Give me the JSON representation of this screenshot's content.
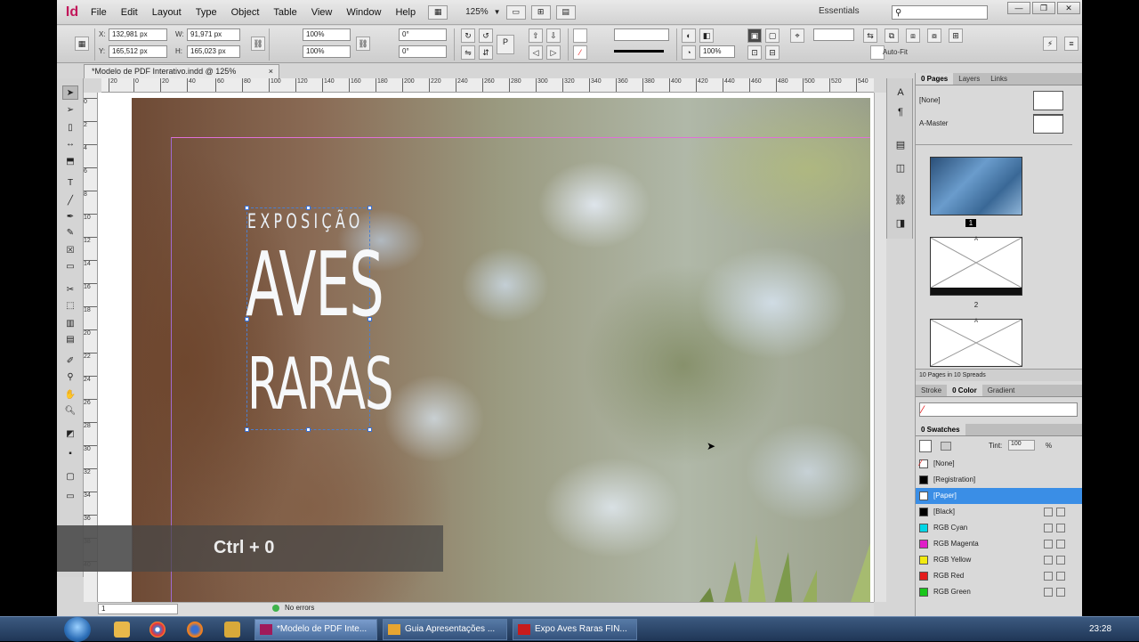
{
  "app": {
    "logo": "Id",
    "menus": [
      "File",
      "Edit",
      "Layout",
      "Type",
      "Object",
      "Table",
      "View",
      "Window",
      "Help"
    ],
    "zoom": "125%",
    "workspace": "Essentials",
    "search_placeholder": ""
  },
  "control": {
    "x": "132,981 px",
    "y": "165,512 px",
    "w": "91,971 px",
    "h": "165,023 px",
    "scale_x": "100%",
    "scale_y": "100%",
    "rotate": "0°",
    "shear": "0°",
    "stroke_pct": "100%",
    "autofit": "Auto-Fit"
  },
  "document": {
    "tab_title": "*Modelo de PDF Interativo.indd @ 125%",
    "close": "×"
  },
  "ruler": {
    "h_labels": [
      "20",
      "0",
      "20",
      "40",
      "60",
      "80",
      "100",
      "120",
      "140",
      "160",
      "180",
      "200",
      "220",
      "240",
      "260",
      "280",
      "300",
      "320",
      "340",
      "360",
      "380",
      "400",
      "420",
      "440",
      "460",
      "480",
      "500",
      "520",
      "540"
    ],
    "v_labels": [
      "0",
      "2",
      "4",
      "6",
      "8",
      "10",
      "12",
      "14",
      "16",
      "18",
      "20",
      "22",
      "24",
      "26",
      "28",
      "30",
      "32",
      "34",
      "36",
      "38",
      "40"
    ]
  },
  "canvas": {
    "line1": "EXPOSIÇÃO",
    "line2": "AVES",
    "line3": "RARAS"
  },
  "overlay": {
    "keystroke": "Ctrl + 0"
  },
  "status": {
    "page": "1",
    "errors": "No errors"
  },
  "pages_panel": {
    "tabs": [
      "0 Pages",
      "Layers",
      "Links"
    ],
    "masters": [
      "[None]",
      "A-Master"
    ],
    "page_labels": [
      "1",
      "2"
    ],
    "master_letter": "A",
    "footer": "10 Pages in 10 Spreads"
  },
  "color_panel": {
    "tabs": [
      "Stroke",
      "0 Color",
      "Gradient"
    ]
  },
  "swatches_panel": {
    "title": "0 Swatches",
    "tint_label": "Tint:",
    "tint_value": "100",
    "tint_unit": "%",
    "items": [
      {
        "name": "[None]",
        "color": "#ffffff"
      },
      {
        "name": "[Registration]",
        "color": "#000000"
      },
      {
        "name": "[Paper]",
        "color": "#ffffff"
      },
      {
        "name": "[Black]",
        "color": "#000000"
      },
      {
        "name": "RGB Cyan",
        "color": "#00d6e6"
      },
      {
        "name": "RGB Magenta",
        "color": "#e01ec8"
      },
      {
        "name": "RGB Yellow",
        "color": "#f2ea10"
      },
      {
        "name": "RGB Red",
        "color": "#e41b1b"
      },
      {
        "name": "RGB Green",
        "color": "#19c61b"
      }
    ]
  },
  "taskbar": {
    "windows": [
      "*Modelo de PDF Inte...",
      "Guia Apresentações ...",
      "Expo Aves Raras FIN..."
    ],
    "clock": "23:28"
  }
}
